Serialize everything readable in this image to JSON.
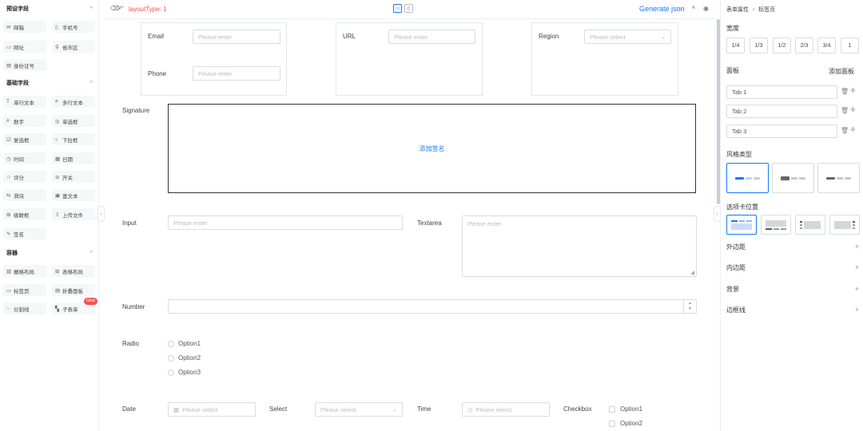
{
  "palette": {
    "preset": {
      "title": "预设字段",
      "items": [
        {
          "icon": "✉",
          "label": "邮箱"
        },
        {
          "icon": "▯",
          "label": "手机号"
        },
        {
          "icon": "▭",
          "label": "网址"
        },
        {
          "icon": "⚲",
          "label": "省市区"
        },
        {
          "icon": "▤",
          "label": "身份证号"
        }
      ]
    },
    "basic": {
      "title": "基础字段",
      "items": [
        {
          "icon": "T",
          "label": "单行文本"
        },
        {
          "icon": "≡",
          "label": "多行文本"
        },
        {
          "icon": "#",
          "label": "数字"
        },
        {
          "icon": "◎",
          "label": "单选框"
        },
        {
          "icon": "☑",
          "label": "复选框"
        },
        {
          "icon": "▿",
          "label": "下拉框"
        },
        {
          "icon": "◷",
          "label": "时间"
        },
        {
          "icon": "▦",
          "label": "日期"
        },
        {
          "icon": "☆",
          "label": "评分"
        },
        {
          "icon": "⊜",
          "label": "开关"
        },
        {
          "icon": "⇆",
          "label": "滑块"
        },
        {
          "icon": "▣",
          "label": "富文本"
        },
        {
          "icon": "⊞",
          "label": "级联框"
        },
        {
          "icon": "⇪",
          "label": "上传文件"
        },
        {
          "icon": "✎",
          "label": "签名"
        }
      ]
    },
    "container": {
      "title": "容器",
      "items": [
        {
          "icon": "▥",
          "label": "栅格布局"
        },
        {
          "icon": "⊞",
          "label": "表格布局"
        },
        {
          "icon": "▭",
          "label": "标签页"
        },
        {
          "icon": "▤",
          "label": "折叠面板"
        },
        {
          "icon": "┄",
          "label": "分割线"
        },
        {
          "icon": "▚",
          "label": "子表单",
          "badge": "new"
        }
      ]
    }
  },
  "toolbar": {
    "layout_type": "layoutType: 1",
    "generate_json": "Generate json"
  },
  "form": {
    "email_label": "Email",
    "email_placeholder": "Please enter",
    "phone_label": "Phone",
    "phone_placeholder": "Please enter",
    "url_label": "URL",
    "url_placeholder": "Please enter",
    "region_label": "Region",
    "region_placeholder": "Please select",
    "signature_label": "Signature",
    "signature_action": "添加签名",
    "input_label": "Input",
    "input_placeholder": "Please enter",
    "textarea_label": "Textarea",
    "textarea_placeholder": "Please enter",
    "number_label": "Number",
    "radio_label": "Radio",
    "radio_options": [
      "Option1",
      "Option2",
      "Option3"
    ],
    "date_label": "Date",
    "date_placeholder": "Please select",
    "select_label": "Select",
    "select_placeholder": "Please select",
    "time_label": "Time",
    "time_placeholder": "Please select",
    "checkbox_label": "Checkbox",
    "checkbox_options": [
      "Option1",
      "Option2"
    ]
  },
  "props": {
    "breadcrumb": [
      "表单属性",
      "标签页"
    ],
    "width_title": "宽度",
    "widths": [
      "1/4",
      "1/3",
      "1/2",
      "2/3",
      "3/4",
      "1"
    ],
    "panel_title": "面板",
    "add_panel": "添加面板",
    "tabs": [
      "Tab 1",
      "Tab 2",
      "Tab 3"
    ],
    "style_title": "风格类型",
    "tab_position_title": "选项卡位置",
    "margin_title": "外边距",
    "padding_title": "内边距",
    "background_title": "背景",
    "border_title": "边框线",
    "accent_color": "#1677ff"
  }
}
